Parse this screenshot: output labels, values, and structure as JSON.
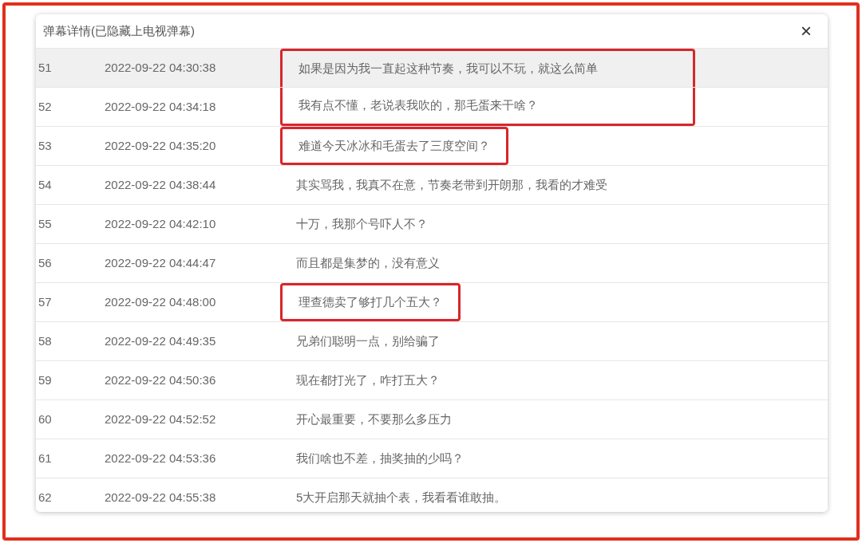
{
  "dialog": {
    "title": "弹幕详情(已隐藏上电视弹幕)",
    "close": "×"
  },
  "rows": [
    {
      "index": "51",
      "time": "2022-09-22 04:30:38",
      "message": "如果是因为我一直起这种节奏，我可以不玩，就这么简单",
      "hovered": true,
      "highlighted": true
    },
    {
      "index": "52",
      "time": "2022-09-22 04:34:18",
      "message": "我有点不懂，老说表我吹的，那毛蛋来干啥？",
      "hovered": false,
      "highlighted": true
    },
    {
      "index": "53",
      "time": "2022-09-22 04:35:20",
      "message": "难道今天冰冰和毛蛋去了三度空间？",
      "hovered": false,
      "highlighted": true,
      "separate_box": true
    },
    {
      "index": "54",
      "time": "2022-09-22 04:38:44",
      "message": "其实骂我，我真不在意，节奏老带到开朗那，我看的才难受",
      "hovered": false,
      "highlighted": false
    },
    {
      "index": "55",
      "time": "2022-09-22 04:42:10",
      "message": "十万，我那个号吓人不？",
      "hovered": false,
      "highlighted": false
    },
    {
      "index": "56",
      "time": "2022-09-22 04:44:47",
      "message": "而且都是集梦的，没有意义",
      "hovered": false,
      "highlighted": false
    },
    {
      "index": "57",
      "time": "2022-09-22 04:48:00",
      "message": "理查德卖了够打几个五大？",
      "hovered": false,
      "highlighted": true
    },
    {
      "index": "58",
      "time": "2022-09-22 04:49:35",
      "message": "兄弟们聪明一点，别给骗了",
      "hovered": false,
      "highlighted": false
    },
    {
      "index": "59",
      "time": "2022-09-22 04:50:36",
      "message": "现在都打光了，咋打五大？",
      "hovered": false,
      "highlighted": false
    },
    {
      "index": "60",
      "time": "2022-09-22 04:52:52",
      "message": "开心最重要，不要那么多压力",
      "hovered": false,
      "highlighted": false
    },
    {
      "index": "61",
      "time": "2022-09-22 04:53:36",
      "message": "我们啥也不差，抽奖抽的少吗？",
      "hovered": false,
      "highlighted": false
    },
    {
      "index": "62",
      "time": "2022-09-22 04:55:38",
      "message": "5大开启那天就抽个表，我看看谁敢抽。",
      "hovered": false,
      "highlighted": false
    }
  ]
}
